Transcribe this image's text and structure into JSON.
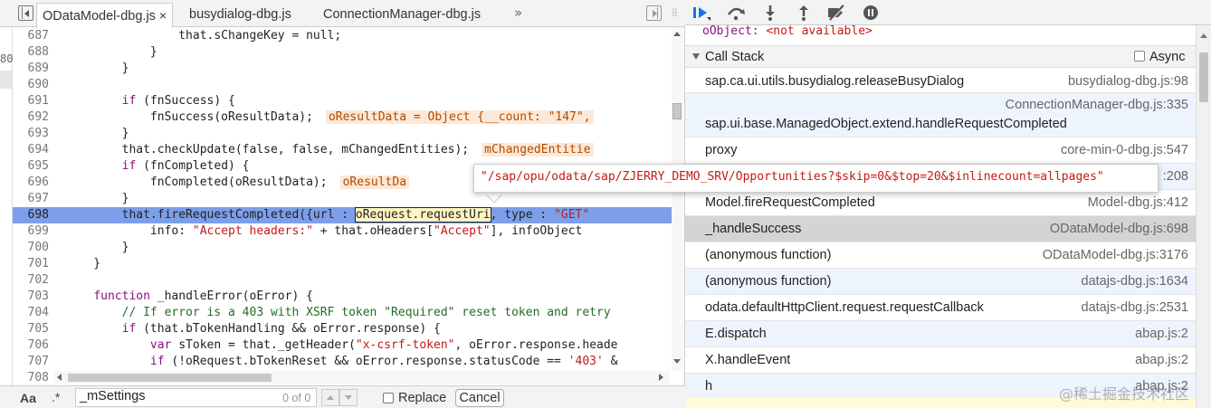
{
  "tabs": [
    {
      "label": "ODataModel-dbg.js",
      "active": true,
      "close": "×"
    },
    {
      "label": "busydialog-dbg.js"
    },
    {
      "label": "ConnectionManager-dbg.js"
    }
  ],
  "tabs_more": "»",
  "tab_divider": "⁞⁞",
  "gutter_partial_number": "80",
  "code_lines": [
    {
      "n": "687",
      "text": "                that.sChangeKey = null;"
    },
    {
      "n": "688",
      "text": "            }"
    },
    {
      "n": "689",
      "text": "        }"
    },
    {
      "n": "690",
      "text": ""
    },
    {
      "n": "691",
      "text": "        if (fnSuccess) {"
    },
    {
      "n": "692",
      "text": "            fnSuccess(oResultData);",
      "chip": "oResultData = Object {__count: \"147\","
    },
    {
      "n": "693",
      "text": "        }"
    },
    {
      "n": "694",
      "text": "        that.checkUpdate(false, false, mChangedEntities);",
      "chip": "mChangedEntitie"
    },
    {
      "n": "695",
      "text": "        if (fnCompleted) {"
    },
    {
      "n": "696",
      "text": "            fnCompleted(oResultData);",
      "chip": "oResultDa"
    },
    {
      "n": "697",
      "text": "        }"
    },
    {
      "n": "698",
      "pre": "        that.fireRequestCompleted({url : ",
      "token": "oRequest.requestUri",
      "post": ", type : \"GET\""
    },
    {
      "n": "699",
      "text": "            info: \"Accept headers:\" + that.oHeaders[\"Accept\"], infoObject"
    },
    {
      "n": "700",
      "text": "        }"
    },
    {
      "n": "701",
      "text": "    }"
    },
    {
      "n": "702",
      "text": ""
    },
    {
      "n": "703",
      "text": "    function _handleError(oError) {"
    },
    {
      "n": "704",
      "text": "        // If error is a 403 with XSRF token \"Required\" reset token and retry"
    },
    {
      "n": "705",
      "text": "        if (that.bTokenHandling && oError.response) {"
    },
    {
      "n": "706",
      "text": "            var sToken = that._getHeader(\"x-csrf-token\", oError.response.heade"
    },
    {
      "n": "707",
      "text": "            if (!oRequest.bTokenReset && oError.response.statusCode == '403' &"
    },
    {
      "n": "708",
      "text": ""
    }
  ],
  "search": {
    "case_label": "Aa",
    "regex_label": ".*",
    "query": "_mSettings",
    "count": "0 of 0",
    "replace_label": "Replace",
    "cancel_label": "Cancel"
  },
  "debugger_toolbar": [
    "resume-icon",
    "step-over-icon",
    "step-into-icon",
    "step-out-icon",
    "deactivate-breakpoints-icon",
    "pause-on-exceptions-icon"
  ],
  "scope_preview": {
    "name": "oObject:",
    "value": "<not available>"
  },
  "call_stack": {
    "title": "Call Stack",
    "async_label": "Async",
    "frames": [
      {
        "fn": "sap.ca.ui.utils.busydialog.releaseBusyDialog",
        "loc": "busydialog-dbg.js:98"
      },
      {
        "fn": "sap.ui.base.ManagedObject.extend.handleRequestCompleted",
        "loc": "ConnectionManager-dbg.js:335"
      },
      {
        "fn": "proxy",
        "loc": "core-min-0-dbg.js:547"
      },
      {
        "fn": "",
        "loc": ":208"
      },
      {
        "fn": "Model.fireRequestCompleted",
        "loc": "Model-dbg.js:412"
      },
      {
        "fn": "_handleSuccess",
        "loc": "ODataModel-dbg.js:698"
      },
      {
        "fn": "(anonymous function)",
        "loc": "ODataModel-dbg.js:3176"
      },
      {
        "fn": "(anonymous function)",
        "loc": "datajs-dbg.js:1634"
      },
      {
        "fn": "odata.defaultHttpClient.request.requestCallback",
        "loc": "datajs-dbg.js:2531"
      },
      {
        "fn": "E.dispatch",
        "loc": "abap.js:2"
      },
      {
        "fn": "X.handleEvent",
        "loc": "abap.js:2"
      },
      {
        "fn": "h",
        "loc": "abap.js:2"
      }
    ]
  },
  "tooltip": "\"/sap/opu/odata/sap/ZJERRY_DEMO_SRV/Opportunities?$skip=0&$top=20&$inlinecount=allpages\"",
  "watermark": "@稀土掘金技术社区",
  "colors": {
    "accent_blue": "#1a73e8",
    "highlight_line": "#7d9ee8",
    "selected_frame": "#d4d4d4",
    "string": "#c41a16",
    "keyword": "#881280",
    "comment": "#236e25"
  }
}
